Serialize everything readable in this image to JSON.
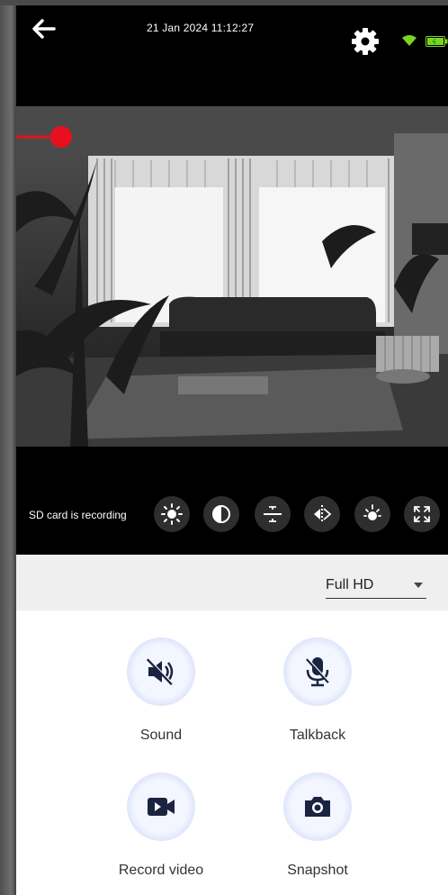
{
  "header": {
    "datetime": "21 Jan 2024 11:12:27",
    "back_icon": "back-arrow-icon",
    "settings_icon": "gear-icon",
    "wifi_icon": "wifi-icon",
    "battery_icon": "battery-icon",
    "status_color": "#7ed321"
  },
  "video": {
    "recording_indicator_color": "#e8101f",
    "sd_status": "SD card is recording"
  },
  "controls": [
    {
      "name": "brightness-icon"
    },
    {
      "name": "contrast-icon"
    },
    {
      "name": "flip-vertical-icon"
    },
    {
      "name": "flip-horizontal-icon"
    },
    {
      "name": "night-vision-icon"
    },
    {
      "name": "fullscreen-icon"
    }
  ],
  "quality": {
    "selected": "Full HD",
    "icon": "chevron-down-icon"
  },
  "actions": {
    "sound": {
      "label": "Sound",
      "icon": "speaker-muted-icon"
    },
    "talkback": {
      "label": "Talkback",
      "icon": "microphone-muted-icon"
    },
    "record": {
      "label": "Record video",
      "icon": "video-camera-icon"
    },
    "snapshot": {
      "label": "Snapshot",
      "icon": "camera-icon"
    },
    "accent_color": "#1a2340"
  }
}
